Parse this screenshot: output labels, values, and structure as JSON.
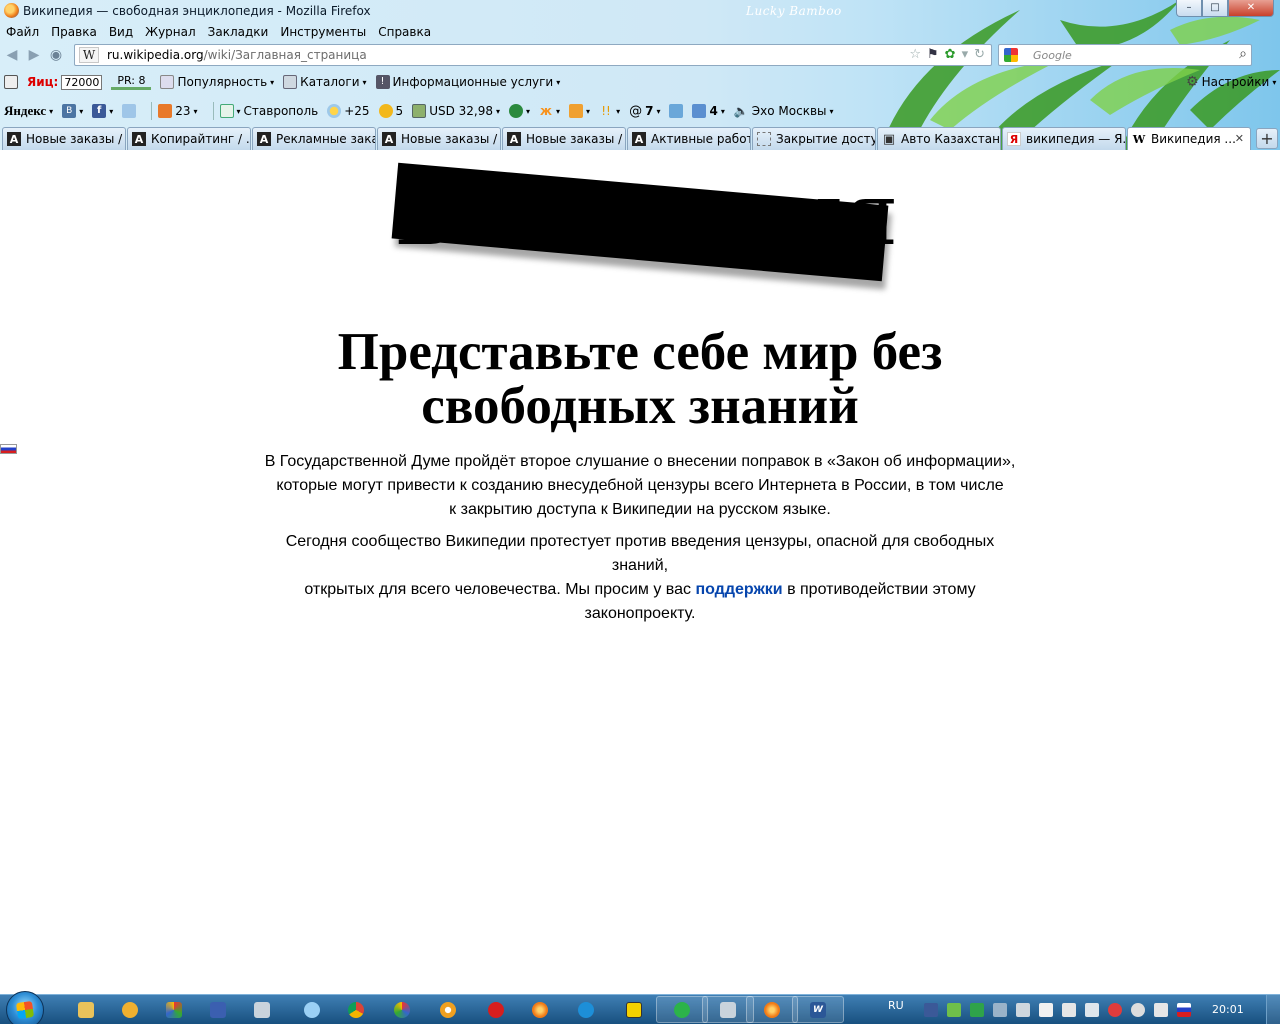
{
  "window": {
    "title": "Википедия — свободная энциклопедия - Mozilla Firefox",
    "theme_brand": "Lucky Bamboo",
    "controls": {
      "minimize": "–",
      "maximize": "□",
      "close": "✕"
    }
  },
  "menu": [
    "Файл",
    "Правка",
    "Вид",
    "Журнал",
    "Закладки",
    "Инструменты",
    "Справка"
  ],
  "nav": {
    "back": "◀",
    "forward": "▶",
    "url_favicon": "W",
    "url_domain": "ru.wikipedia.org",
    "url_path": "/wiki/Заглавная_страница",
    "search_placeholder": "Google"
  },
  "toolbar1": {
    "tic_label": "Яиц:",
    "tic_value": "72000",
    "pr": "PR: 8",
    "popularity": "Популярность",
    "catalogs": "Каталоги",
    "info_services": "Информационные услуги",
    "settings": "Настройки"
  },
  "toolbar2": {
    "yandex": "Яндекс",
    "mail_count": "23",
    "city": "Ставрополь",
    "weather": "+25",
    "traffic": "5",
    "currency": "USD 32,98",
    "at_count": "7",
    "letters_count": "4",
    "radio": "Эхо Москвы"
  },
  "tabs": [
    {
      "label": "Новые заказы / ...",
      "favicon": "A",
      "active": false
    },
    {
      "label": "Копирайтинг / ...",
      "favicon": "A",
      "active": false
    },
    {
      "label": "Рекламные зака...",
      "favicon": "A",
      "active": false
    },
    {
      "label": "Новые заказы / ...",
      "favicon": "A",
      "active": false
    },
    {
      "label": "Новые заказы / ...",
      "favicon": "A",
      "active": false
    },
    {
      "label": "Активные работ...",
      "favicon": "A",
      "active": false
    },
    {
      "label": "Закрытие досту...",
      "favicon": "",
      "active": false
    },
    {
      "label": "Авто Казахстана...",
      "favicon": "▣",
      "active": false
    },
    {
      "label": "википедия — Я...",
      "favicon": "Я",
      "active": false
    },
    {
      "label": "Википедия ...",
      "favicon": "W",
      "active": true
    }
  ],
  "page": {
    "logo_text": "Википедия",
    "headline_line1": "Представьте себе мир без",
    "headline_line2": "свободных знаний",
    "para1_line1": "В Государственной Думе пройдёт второе слушание о внесении поправок в «Закон об информации»,",
    "para1_line2": "которые могут привести к созданию внесудебной цензуры всего Интернета в России, в том числе",
    "para1_line3": "к закрытию доступа к Википедии на русском языке.",
    "para2_line1": "Сегодня сообщество Википедии протестует против введения цензуры, опасной для свободных знаний,",
    "para2_line2_before": "открытых для всего человечества. Мы просим у вас ",
    "para2_link": "поддержки",
    "para2_line2_after": " в противодействии этому",
    "para2_line3": "законопроекту."
  },
  "taskbar": {
    "language": "RU",
    "clock": "20:01"
  },
  "colors": {
    "link": "#0645ad",
    "taskbar": "#1f5b8f",
    "chrome_sky": "#cfe8f6"
  }
}
